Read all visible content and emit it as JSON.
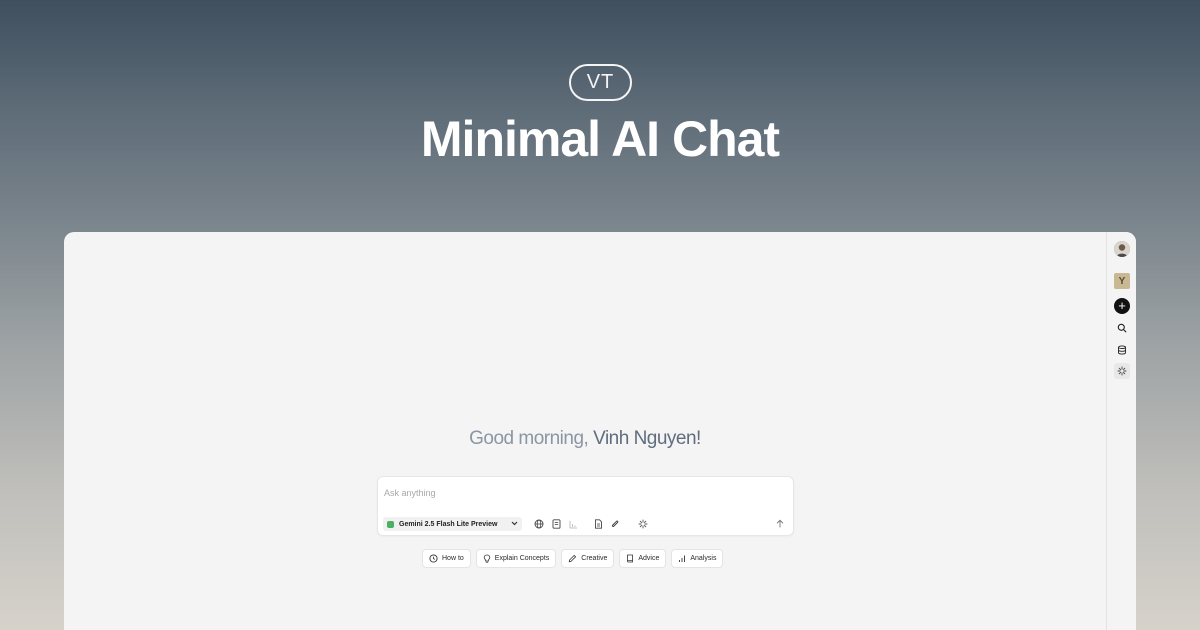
{
  "hero": {
    "badge": "VT",
    "title": "Minimal AI Chat"
  },
  "greeting": {
    "prefix": "Good morning,",
    "name": "Vinh Nguyen!"
  },
  "composer": {
    "placeholder": "Ask anything",
    "model": "Gemini 2.5 Flash Lite Preview",
    "tools": [
      "globe-icon",
      "document-icon",
      "chart-icon",
      "file-icon",
      "paperclip-icon",
      "sparkle-icon"
    ],
    "send_icon": "arrow-up-icon"
  },
  "suggestions": [
    {
      "label": "How to",
      "icon": "clock-icon"
    },
    {
      "label": "Explain Concepts",
      "icon": "lightbulb-icon"
    },
    {
      "label": "Creative",
      "icon": "pencil-icon"
    },
    {
      "label": "Advice",
      "icon": "book-icon"
    },
    {
      "label": "Analysis",
      "icon": "bar-chart-icon"
    }
  ],
  "rail": {
    "brand_letter": "Y",
    "new_chat_symbol": "+",
    "icons": [
      "avatar",
      "brand-icon",
      "plus-icon",
      "search-icon",
      "database-icon",
      "sparkle-icon"
    ]
  },
  "colors": {
    "model_indicator": "#4bb064",
    "new_chat_bg": "#111111",
    "greeting_muted": "#8b96a4",
    "greeting_name": "#5f6d7e"
  }
}
